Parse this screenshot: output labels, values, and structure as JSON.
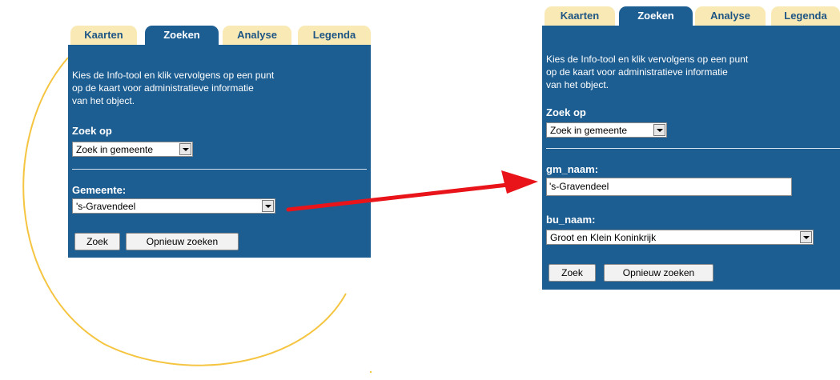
{
  "left_panel": {
    "tabs": [
      {
        "label": "Kaarten",
        "active": false
      },
      {
        "label": "Zoeken",
        "active": true
      },
      {
        "label": "Analyse",
        "active": false
      },
      {
        "label": "Legenda",
        "active": false
      }
    ],
    "info_text": "Kies de Info-tool en klik vervolgens op een punt\nop de kaart voor administratieve informatie\nvan het object.",
    "zoek_op_label": "Zoek op",
    "zoek_op_value": "Zoek in gemeente",
    "gemeente_label": "Gemeente:",
    "gemeente_value": "'s-Gravendeel",
    "zoek_button": "Zoek",
    "opnieuw_button": "Opnieuw zoeken"
  },
  "right_panel": {
    "tabs": [
      {
        "label": "Kaarten",
        "active": false
      },
      {
        "label": "Zoeken",
        "active": true
      },
      {
        "label": "Analyse",
        "active": false
      },
      {
        "label": "Legenda",
        "active": false
      }
    ],
    "info_text": "Kies de Info-tool en klik vervolgens op een punt\nop de kaart voor administratieve informatie\nvan het object.",
    "zoek_op_label": "Zoek op",
    "zoek_op_value": "Zoek in gemeente",
    "gm_naam_label": "gm_naam:",
    "gm_naam_value": "'s-Gravendeel",
    "bu_naam_label": "bu_naam:",
    "bu_naam_value": "Groot en Klein Koninkrijk",
    "zoek_button": "Zoek",
    "opnieuw_button": "Opnieuw zoeken"
  },
  "colors": {
    "panel_bg": "#1d5e92",
    "tab_inactive_bg": "#f9e9b4",
    "tab_text": "#1e5585",
    "arc": "#f5c542",
    "arrow": "#e8141a"
  }
}
